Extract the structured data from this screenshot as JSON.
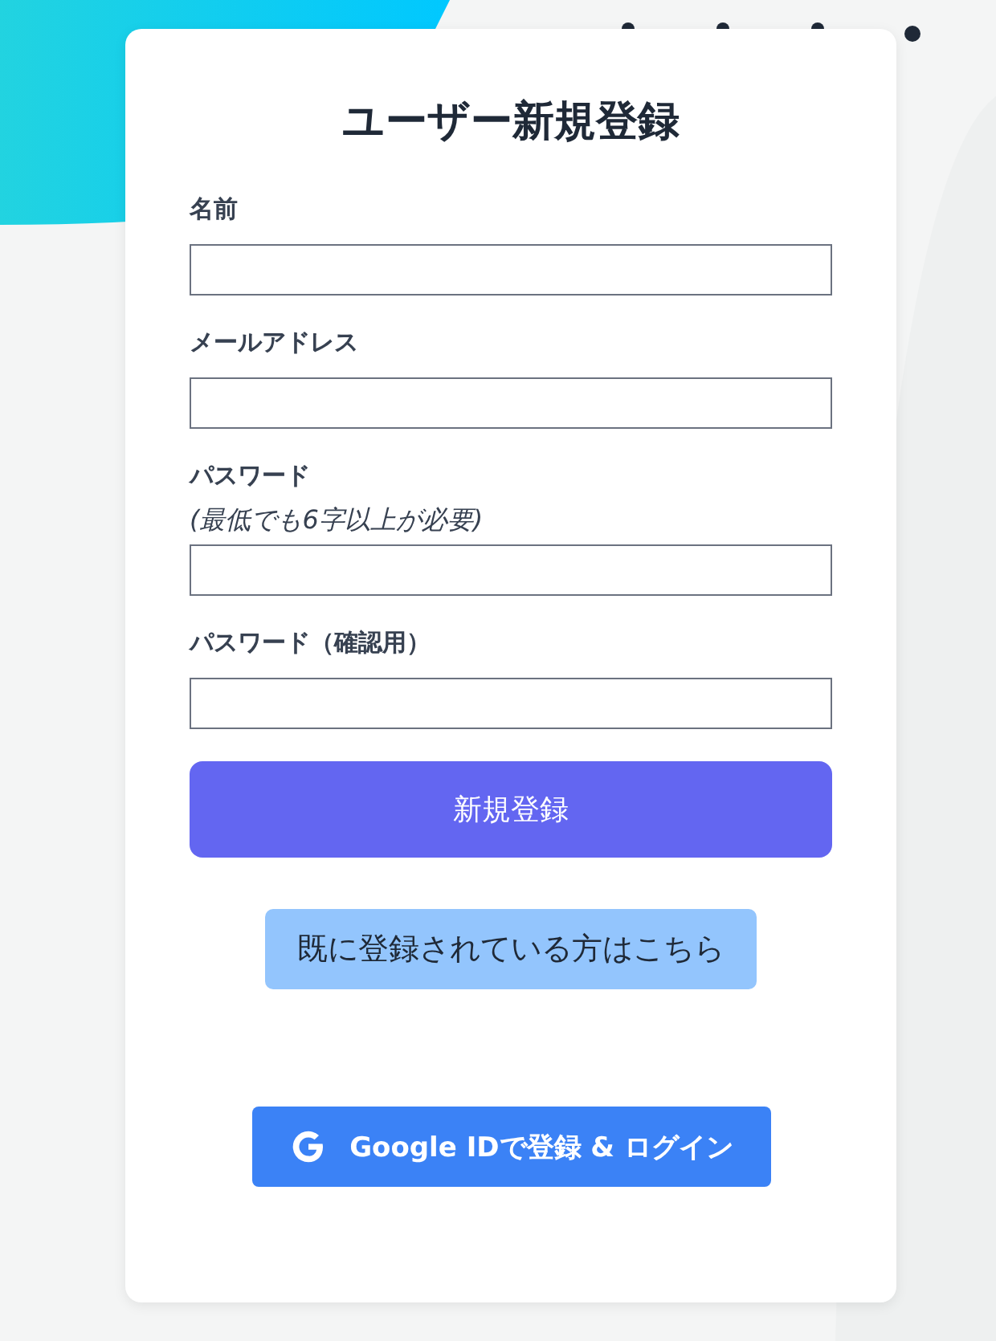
{
  "title": "ユーザー新規登録",
  "fields": [
    {
      "label": "名前"
    },
    {
      "label": "メールアドレス"
    },
    {
      "label": "パスワード",
      "note": "(最低でも6字以上が必要)"
    },
    {
      "label": "パスワード（確認用）"
    }
  ],
  "submit_button": "新規登録",
  "login_link_button": "既に登録されている方はこちら",
  "google_button": "Google IDで登録 & ログイン"
}
